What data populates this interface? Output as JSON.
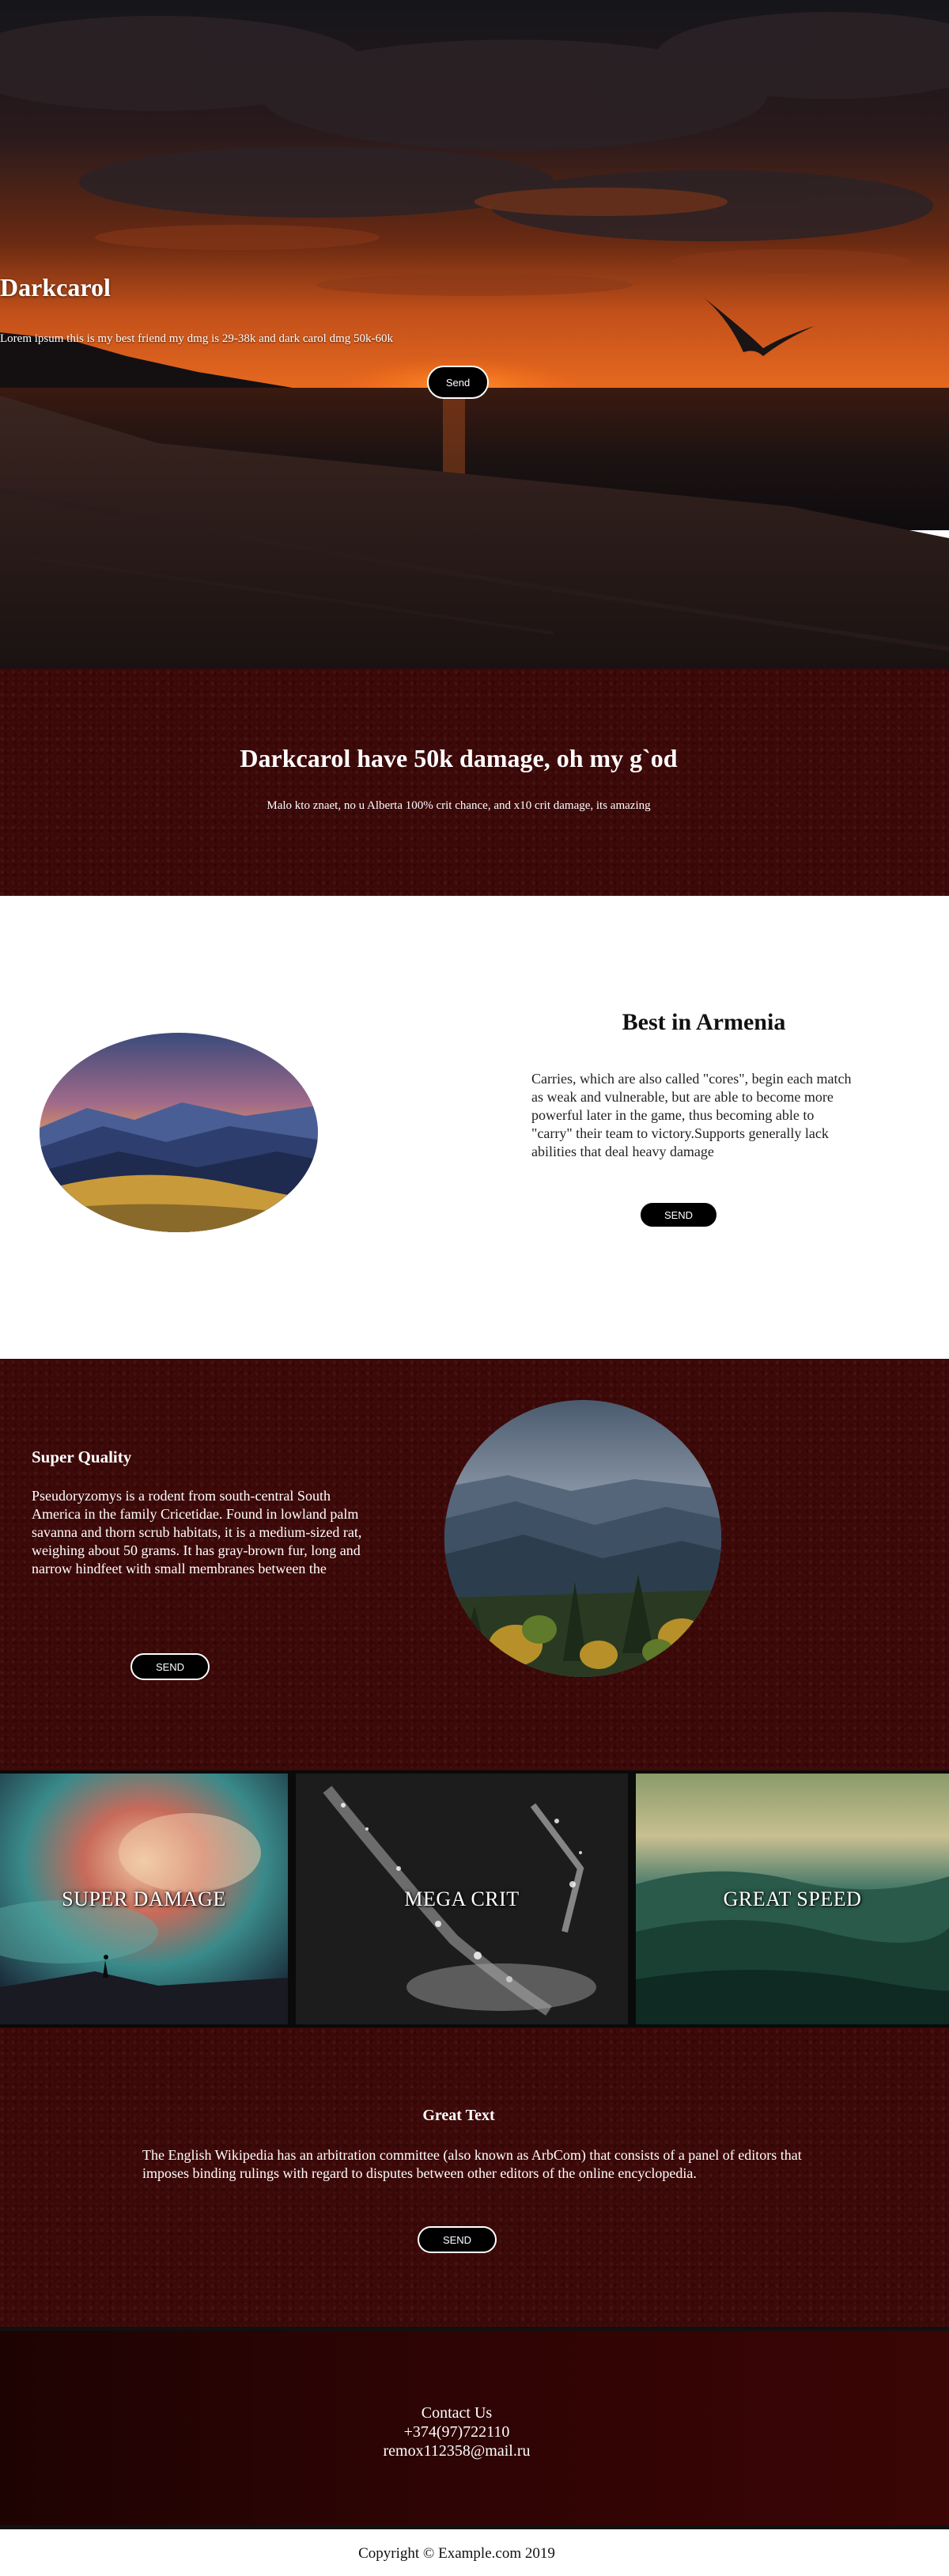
{
  "hero": {
    "title": "Darkcarol",
    "subtitle": "Lorem ipsum this is my best friend my dmg is 29-38k and dark carol dmg 50k-60k",
    "button_label": "Send"
  },
  "damage": {
    "title": "Darkcarol have 50k damage, oh my g`od",
    "text": "Malo kto znaet, no u Alberta 100% crit chance, and x10 crit damage, its amazing"
  },
  "armenia": {
    "title": "Best in Armenia",
    "text": "Carries, which are also called \"cores\", begin each match as weak and vulnerable, but are able to become more powerful later in the game, thus becoming able to \"carry\" their team to victory.Supports generally lack abilities that deal heavy damage",
    "button_label": "SEND"
  },
  "quality": {
    "title": "Super Quality",
    "text": "Pseudoryzomys is a rodent from south-central South America in the family Cricetidae. Found in lowland palm savanna and thorn scrub habitats, it is a medium-sized rat, weighing about 50 grams. It has gray-brown fur, long and narrow hindfeet with small membranes between the",
    "button_label": "SEND"
  },
  "tiles": [
    {
      "label": "SUPER DAMAGE"
    },
    {
      "label": "MEGA CRIT"
    },
    {
      "label": "GREAT SPEED"
    }
  ],
  "great": {
    "title": "Great Text",
    "text": "The English Wikipedia has an arbitration committee (also known as ArbCom) that consists of a panel of editors that imposes binding rulings with regard to disputes between other editors of the online encyclopedia.",
    "button_label": "SEND"
  },
  "contact": {
    "title": "Contact Us",
    "phone": "+374(97)722110",
    "email": "remox112358@mail.ru"
  },
  "footer": {
    "copyright": "Copyright © Example.com 2019"
  },
  "colors": {
    "dark_red": "#3d0808",
    "button_bg": "#000000",
    "white": "#ffffff"
  }
}
